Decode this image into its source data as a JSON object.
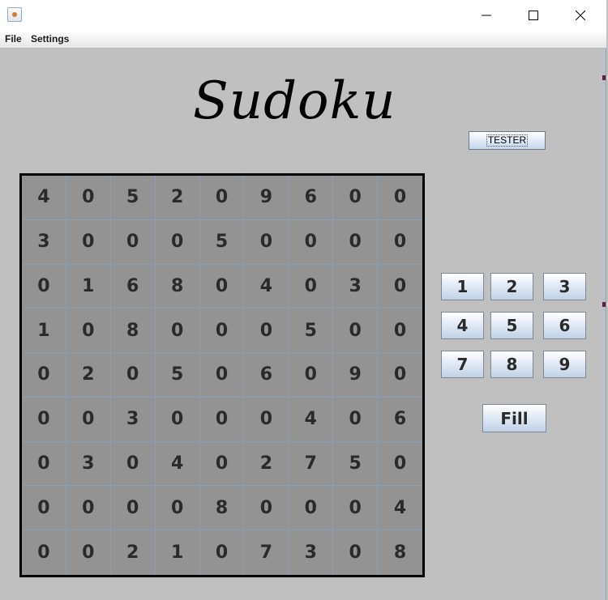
{
  "window": {
    "minimize_icon": "minimize-icon",
    "maximize_icon": "maximize-icon",
    "close_icon": "close-icon",
    "app_icon": "java-icon"
  },
  "menu": {
    "file_label": "File",
    "settings_label": "Settings"
  },
  "title": "Sudoku",
  "tester_label": "TESTER",
  "board": [
    [
      "4",
      "0",
      "5",
      "2",
      "0",
      "9",
      "6",
      "0",
      "0"
    ],
    [
      "3",
      "0",
      "0",
      "0",
      "5",
      "0",
      "0",
      "0",
      "0"
    ],
    [
      "0",
      "1",
      "6",
      "8",
      "0",
      "4",
      "0",
      "3",
      "0"
    ],
    [
      "1",
      "0",
      "8",
      "0",
      "0",
      "0",
      "5",
      "0",
      "0"
    ],
    [
      "0",
      "2",
      "0",
      "5",
      "0",
      "6",
      "0",
      "9",
      "0"
    ],
    [
      "0",
      "0",
      "3",
      "0",
      "0",
      "0",
      "4",
      "0",
      "6"
    ],
    [
      "0",
      "3",
      "0",
      "4",
      "0",
      "2",
      "7",
      "5",
      "0"
    ],
    [
      "0",
      "0",
      "0",
      "0",
      "8",
      "0",
      "0",
      "0",
      "4"
    ],
    [
      "0",
      "0",
      "2",
      "1",
      "0",
      "7",
      "3",
      "0",
      "8"
    ]
  ],
  "keypad": [
    "1",
    "2",
    "3",
    "4",
    "5",
    "6",
    "7",
    "8",
    "9"
  ],
  "fill_label": "Fill",
  "colors": {
    "background": "#c0c0c0",
    "board": "#939393",
    "board_border": "#000000"
  }
}
